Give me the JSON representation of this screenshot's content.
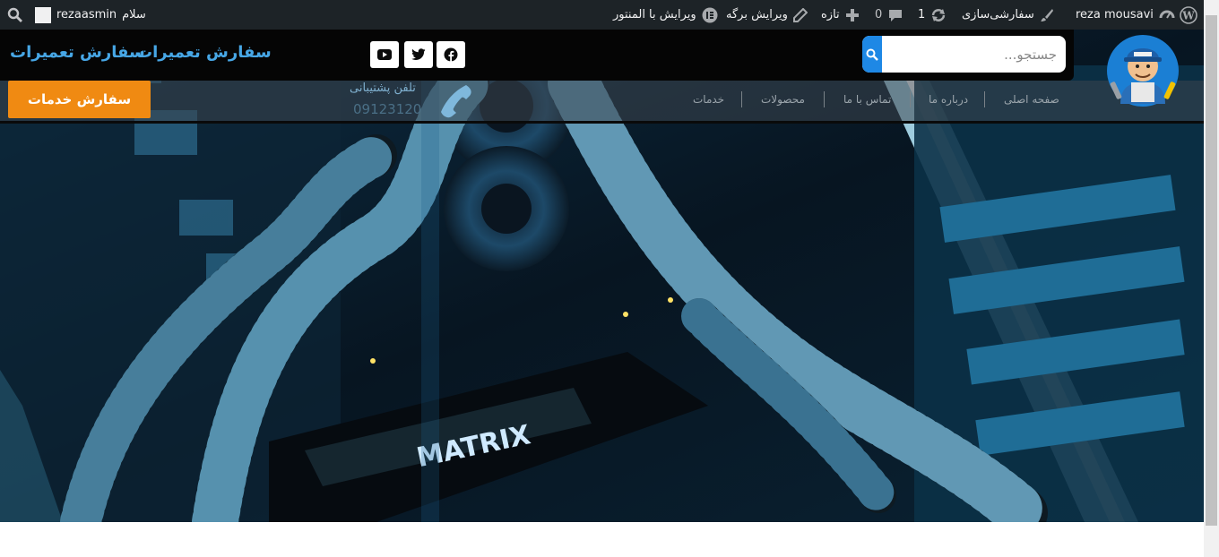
{
  "admin_bar": {
    "username": "reza mousavi",
    "customize": "سفارشی‌سازی",
    "updates_count": "1",
    "comments_count": "0",
    "new_label": "تازه",
    "edit_page": "ویرایش برگه",
    "edit_elementor": "ویرایش با المنتور",
    "elementor_badge": "IE",
    "greeting_name": "rezaasmin",
    "greeting": "سلام"
  },
  "header": {
    "site_title_1": "سفارش تعمیرات",
    "site_title_2": "سفارش تعمیرات",
    "search_placeholder": "جستجو...",
    "social_icons": [
      "youtube-icon",
      "twitter-icon",
      "facebook-icon"
    ],
    "order_button": "سفارش خدمات",
    "phone_label": "تلفن پشتیبانی",
    "phone_number": "09123120"
  },
  "nav": {
    "items": [
      "صفحه اصلی",
      "درباره ما",
      "تماس با ما",
      "محصولات",
      "خدمات"
    ]
  },
  "hero": {
    "card_brand": "MATRIX"
  },
  "colors": {
    "admin_bar": "#1d2327",
    "accent_blue": "#47a7e6",
    "search_button": "#1e88e5",
    "order_button": "#f08a12",
    "header_bg": "#050505"
  }
}
